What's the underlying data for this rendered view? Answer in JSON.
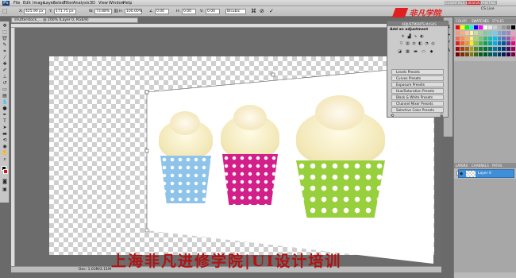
{
  "menu": [
    "Ps",
    "File",
    "Edit",
    "Image",
    "Layer",
    "Select",
    "Filter",
    "Analysis",
    "3D",
    "View",
    "Window",
    "Help"
  ],
  "options": {
    "x_label": "X:",
    "x": "425.90 px",
    "y_label": "Y:",
    "y": "171.75 px",
    "w_label": "W:",
    "w": "73.88%",
    "h_label": "H:",
    "h": "100.00%",
    "angle_label": "∠",
    "angle": "0.00",
    "h2_label": "H:",
    "h2": "0.00",
    "v_label": "V:",
    "v": "0.00",
    "interp": "Bicubic"
  },
  "workspace": {
    "essentials": "ESSENTIALS ▾",
    "design": "DESIGN",
    "painting": "PAINTING",
    "cs_live": "CS Live"
  },
  "logo": "非凡学院",
  "document_tab": "shutterstock_... @ 200% (Layer 0, RGB/8)",
  "status": "Doc: 1.03M/2.11M",
  "swatches_tabs": [
    "COLOR",
    "SWATCHES",
    "STYLES"
  ],
  "adjustments": {
    "tabs": [
      "ADJUSTMENTS",
      "MASKS"
    ],
    "title": "Add an adjustment",
    "presets": [
      "Levels Presets",
      "Curves Presets",
      "Exposure Presets",
      "Hue/Saturation Presets",
      "Black & White Presets",
      "Channel Mixer Presets",
      "Selective Color Presets"
    ]
  },
  "layers": {
    "tabs": [
      "LAYERS",
      "CHANNELS",
      "PATHS"
    ],
    "blend_mode": "Normal",
    "opacity_label": "Opacity:",
    "layer_name": "Layer 0"
  },
  "banner": "上海非凡进修学院|UI设计培训",
  "colors": {
    "accent": "#3f8fd8",
    "banner": "#b11212",
    "fg_color": "#000000",
    "bg_color": "#d21414"
  }
}
